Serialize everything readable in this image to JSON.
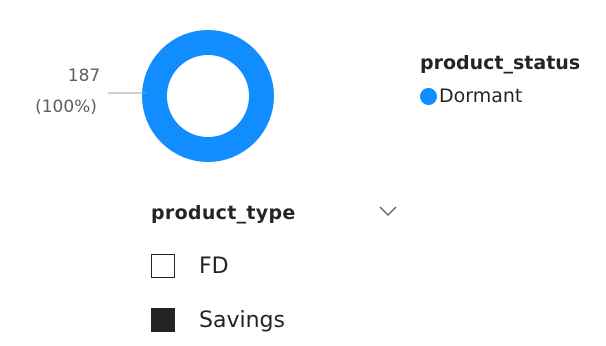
{
  "chart_data": {
    "type": "pie",
    "variant": "donut",
    "categories": [
      "Dormant"
    ],
    "values": [
      187
    ],
    "data_labels": [
      {
        "value": "187",
        "percent": "(100%)"
      }
    ],
    "legend": {
      "title": "product_status",
      "placement": "right",
      "entries": [
        {
          "label": "Dormant",
          "color": "#118DFF"
        }
      ]
    }
  },
  "slicer": {
    "title": "product_type",
    "expand_icon": "chevron-down-icon",
    "items": [
      {
        "label": "FD",
        "checked": false
      },
      {
        "label": "Savings",
        "checked": true
      }
    ]
  },
  "colors": {
    "series": "#118DFF",
    "text": "#252423",
    "leader_line": "#A0A0A0"
  }
}
